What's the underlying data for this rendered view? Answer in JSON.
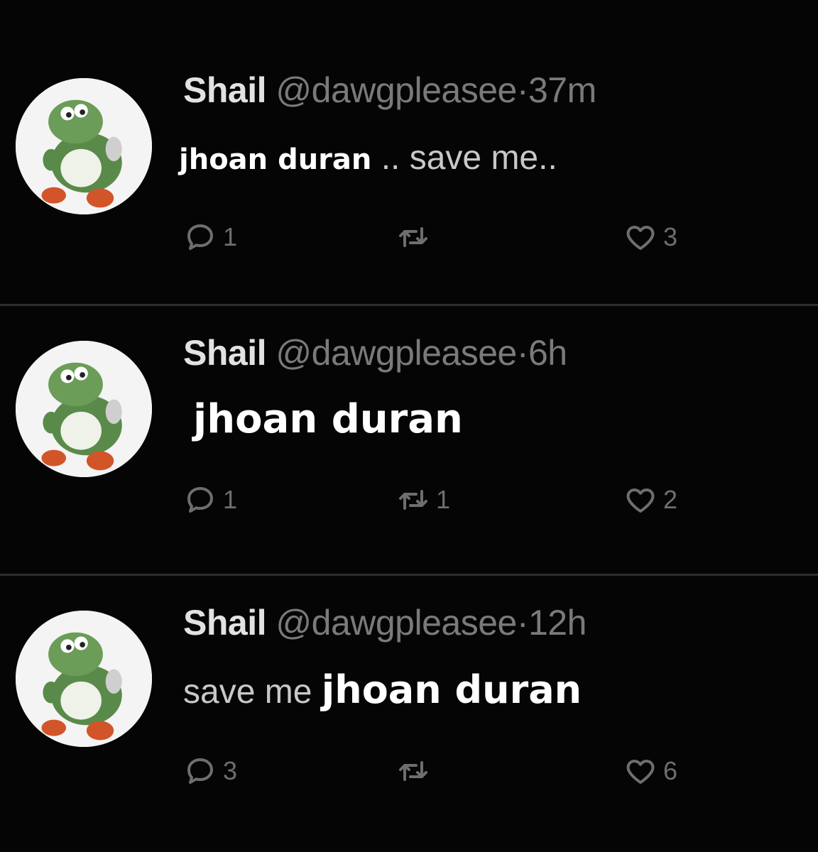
{
  "tweets": [
    {
      "name": "Shail",
      "handle": "@dawgpleasee",
      "separator": "·",
      "time": "37m",
      "body_overlay": "jhoan duran",
      "body_text": " .. save me..",
      "replies": "1",
      "retweets": "",
      "likes": "3"
    },
    {
      "name": "Shail",
      "handle": "@dawgpleasee",
      "separator": "·",
      "time": "6h",
      "body_overlay": "jhoan duran",
      "body_text": "",
      "replies": "1",
      "retweets": "1",
      "likes": "2"
    },
    {
      "name": "Shail",
      "handle": "@dawgpleasee",
      "separator": "·",
      "time": "12h",
      "body_prefix": "save me ",
      "body_overlay": "jhoan duran",
      "replies": "3",
      "retweets": "",
      "likes": "6"
    }
  ],
  "icons": {
    "reply": "reply-icon",
    "retweet": "retweet-icon",
    "like": "heart-icon",
    "avatar": "yoshi-avatar"
  },
  "colors": {
    "background": "#050505",
    "muted": "#7a7a7a",
    "overlay_text": "#ffffff"
  }
}
